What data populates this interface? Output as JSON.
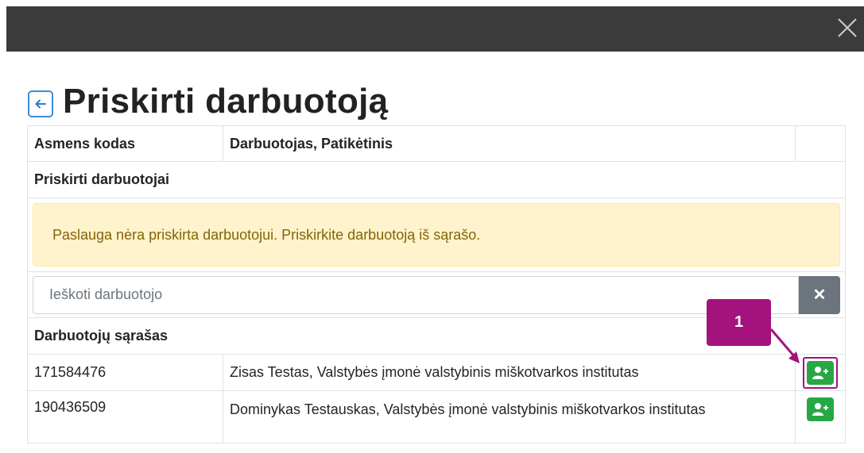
{
  "modal": {
    "close_icon": "close-icon"
  },
  "header": {
    "title": "Priskirti darbuotoją",
    "back_icon": "arrow-left-icon"
  },
  "table": {
    "columns": [
      "Asmens kodas",
      "Darbuotojas, Patikėtinis"
    ],
    "assigned_section": "Priskirti darbuotojai",
    "alert": "Paslauga nėra priskirta darbuotojui. Priskirkite darbuotoją iš sąrašo.",
    "search": {
      "placeholder": "Ieškoti darbuotojo",
      "value": ""
    },
    "list_section": "Darbuotojų sąrašas",
    "rows": [
      {
        "code": "171584476",
        "name": "Zisas Testas, Valstybės įmonė valstybinis miškotvarkos institutas"
      },
      {
        "code": "190436509",
        "name": "Dominykas Testauskas, Valstybės įmonė valstybinis miškotvarkos institutas"
      }
    ]
  },
  "annotation": {
    "label": "1",
    "color": "#a4127e"
  },
  "colors": {
    "alert_bg": "#fff3cd",
    "alert_text": "#856404",
    "add_button": "#28a745",
    "clear_button": "#6c757d"
  }
}
